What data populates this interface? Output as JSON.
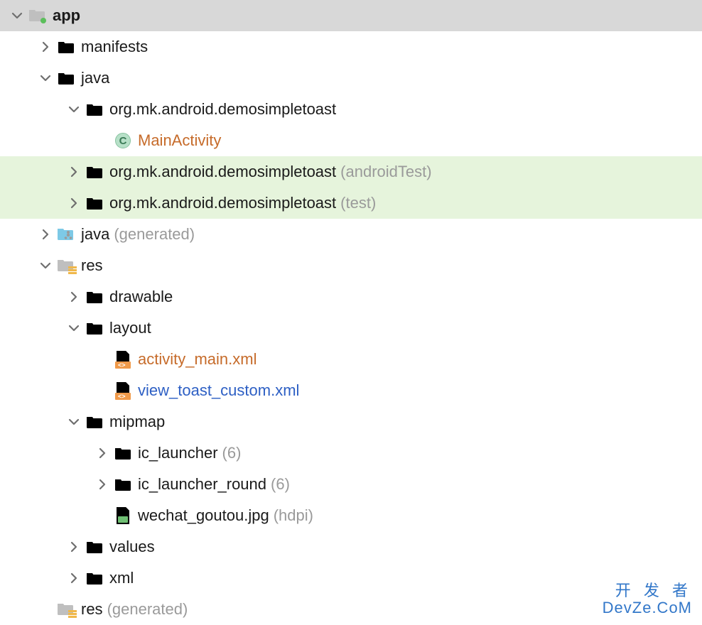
{
  "watermark": {
    "line1": "开 发 者",
    "line2": "DevZe.CoM"
  },
  "tree": {
    "root": {
      "label": "app"
    },
    "manifests": {
      "label": "manifests"
    },
    "java": {
      "label": "java"
    },
    "pkg": {
      "label": "org.mk.android.demosimpletoast"
    },
    "main_activity": {
      "label": "MainActivity"
    },
    "pkg_android_test": {
      "label": "org.mk.android.demosimpletoast",
      "suffix": "(androidTest)"
    },
    "pkg_test": {
      "label": "org.mk.android.demosimpletoast",
      "suffix": "(test)"
    },
    "java_generated": {
      "label": "java",
      "suffix": "(generated)"
    },
    "res": {
      "label": "res"
    },
    "drawable": {
      "label": "drawable"
    },
    "layout": {
      "label": "layout"
    },
    "activity_main": {
      "label": "activity_main.xml"
    },
    "view_toast_custom": {
      "label": "view_toast_custom.xml"
    },
    "mipmap": {
      "label": "mipmap"
    },
    "ic_launcher": {
      "label": "ic_launcher",
      "suffix": "(6)"
    },
    "ic_launcher_round": {
      "label": "ic_launcher_round",
      "suffix": "(6)"
    },
    "wechat_goutou": {
      "label": "wechat_goutou.jpg",
      "suffix": "(hdpi)"
    },
    "values": {
      "label": "values"
    },
    "xml": {
      "label": "xml"
    },
    "res_generated": {
      "label": "res",
      "suffix": "(generated)"
    }
  }
}
